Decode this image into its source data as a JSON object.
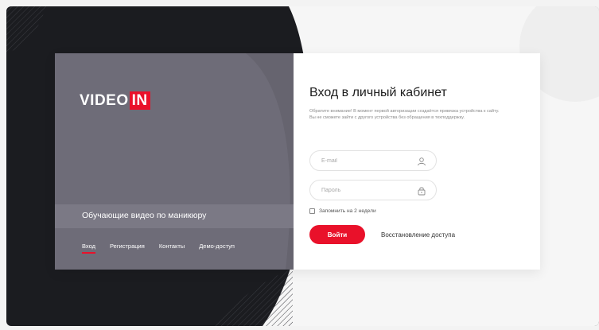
{
  "brand": {
    "logo_text": "VIDEO",
    "logo_badge": "IN",
    "accent": "#e9112a"
  },
  "left_panel": {
    "tagline": "Обучающие видео по маникюру"
  },
  "nav": {
    "items": [
      "Вход",
      "Регистрация",
      "Контакты",
      "Демо-доступ"
    ],
    "active_index": 0
  },
  "login": {
    "title": "Вход в личный кабинет",
    "notice": "Обратите внимание! В момент первой авторизации создаётся привязка устройства к сайту. Вы не сможете зайти с другого устройства без обращения в техподдержку.",
    "email_placeholder": "E-mail",
    "email_icon": "user-icon",
    "password_placeholder": "Пароль",
    "password_icon": "lock-icon",
    "remember_label": "Запомнить на 2 недели",
    "submit_label": "Войти",
    "restore_label": "Восстановление доступа"
  }
}
